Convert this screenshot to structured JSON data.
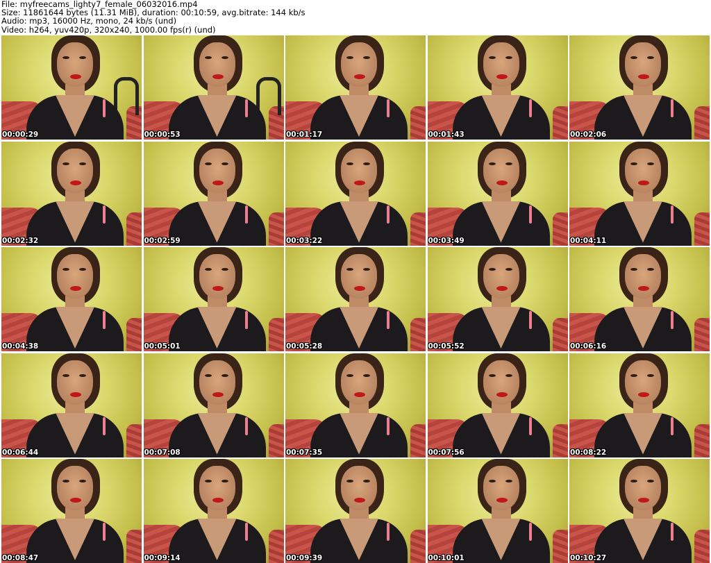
{
  "header": {
    "file_line": "File: myfreecams_lighty7_female_06032016.mp4",
    "size_line": "Size: 11861644 bytes (11.31 MiB), duration: 00:10:59, avg.bitrate: 144 kb/s",
    "audio_line": "Audio: mp3, 16000 Hz, mono, 24 kb/s (und)",
    "video_line": "Video: h264, yuv420p, 320x240, 1000.00 fps(r) (und)"
  },
  "thumbnails": [
    {
      "timestamp": "00:00:29"
    },
    {
      "timestamp": "00:00:53"
    },
    {
      "timestamp": "00:01:17"
    },
    {
      "timestamp": "00:01:43"
    },
    {
      "timestamp": "00:02:06"
    },
    {
      "timestamp": "00:02:32"
    },
    {
      "timestamp": "00:02:59"
    },
    {
      "timestamp": "00:03:22"
    },
    {
      "timestamp": "00:03:49"
    },
    {
      "timestamp": "00:04:11"
    },
    {
      "timestamp": "00:04:38"
    },
    {
      "timestamp": "00:05:01"
    },
    {
      "timestamp": "00:05:28"
    },
    {
      "timestamp": "00:05:52"
    },
    {
      "timestamp": "00:06:16"
    },
    {
      "timestamp": "00:06:44"
    },
    {
      "timestamp": "00:07:08"
    },
    {
      "timestamp": "00:07:35"
    },
    {
      "timestamp": "00:07:56"
    },
    {
      "timestamp": "00:08:22"
    },
    {
      "timestamp": "00:08:47"
    },
    {
      "timestamp": "00:09:14"
    },
    {
      "timestamp": "00:09:39"
    },
    {
      "timestamp": "00:10:01"
    },
    {
      "timestamp": "00:10:27"
    }
  ],
  "colors": {
    "background": "#ffffff",
    "timestamp_text": "#ffffff",
    "wall": "#dcd96e",
    "couch": "#c9544a",
    "top": "#1c1a1c",
    "lips": "#c0171d"
  }
}
